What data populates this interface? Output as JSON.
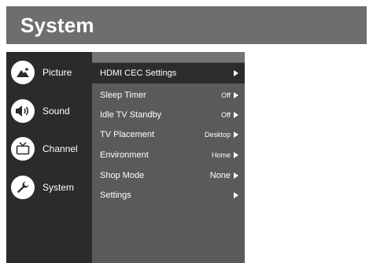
{
  "header": {
    "title": "System"
  },
  "sidebar": {
    "items": [
      {
        "label": "Picture",
        "icon": "picture-icon"
      },
      {
        "label": "Sound",
        "icon": "sound-icon"
      },
      {
        "label": "Channel",
        "icon": "channel-icon"
      },
      {
        "label": "System",
        "icon": "wrench-icon"
      }
    ]
  },
  "menu": {
    "selected_index": 0,
    "items": [
      {
        "label": "HDMI CEC Settings",
        "value": ""
      },
      {
        "label": "Sleep Timer",
        "value": "Off"
      },
      {
        "label": "Idle TV Standby",
        "value": "Off"
      },
      {
        "label": "TV Placement",
        "value": "Desktop"
      },
      {
        "label": "Environment",
        "value": "Home"
      },
      {
        "label": "Shop Mode",
        "value": "None"
      },
      {
        "label": "Settings",
        "value": ""
      }
    ]
  },
  "colors": {
    "header_bg": "#6e6e6e",
    "sidebar_bg": "#2b2b2b",
    "panel_bg": "#5a5a5a",
    "selected_row_bg": "#2c2c2c",
    "text": "#ffffff"
  }
}
